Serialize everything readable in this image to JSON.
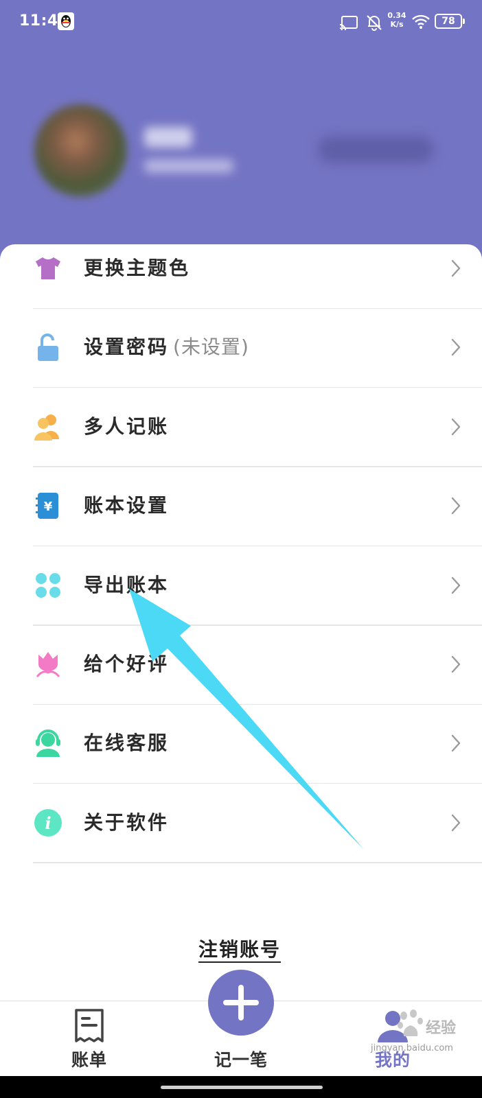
{
  "status_bar": {
    "time": "11:41",
    "speed_value": "0.34",
    "speed_unit": "K/s",
    "battery": "78"
  },
  "menu": [
    {
      "id": "theme",
      "label": "更换主题色",
      "note": "",
      "icon": "tshirt-icon"
    },
    {
      "id": "password",
      "label": "设置密码",
      "note": "(未设置)",
      "icon": "unlock-icon"
    },
    {
      "id": "multi",
      "label": "多人记账",
      "note": "",
      "icon": "users-icon"
    },
    {
      "id": "book",
      "label": "账本设置",
      "note": "",
      "icon": "ledger-icon"
    },
    {
      "id": "export",
      "label": "导出账本",
      "note": "",
      "icon": "clover-icon"
    },
    {
      "id": "rate",
      "label": "给个好评",
      "note": "",
      "icon": "flower-icon"
    },
    {
      "id": "service",
      "label": "在线客服",
      "note": "",
      "icon": "headset-icon"
    },
    {
      "id": "about",
      "label": "关于软件",
      "note": "",
      "icon": "info-icon"
    }
  ],
  "logout_label": "注销账号",
  "nav": {
    "bill": "账单",
    "add": "记一笔",
    "mine": "我的"
  },
  "watermark": {
    "text": "jingyan.baidu.com",
    "brand": "经验"
  },
  "colors": {
    "header": "#7474c4",
    "arrow": "#4cd9f5"
  }
}
